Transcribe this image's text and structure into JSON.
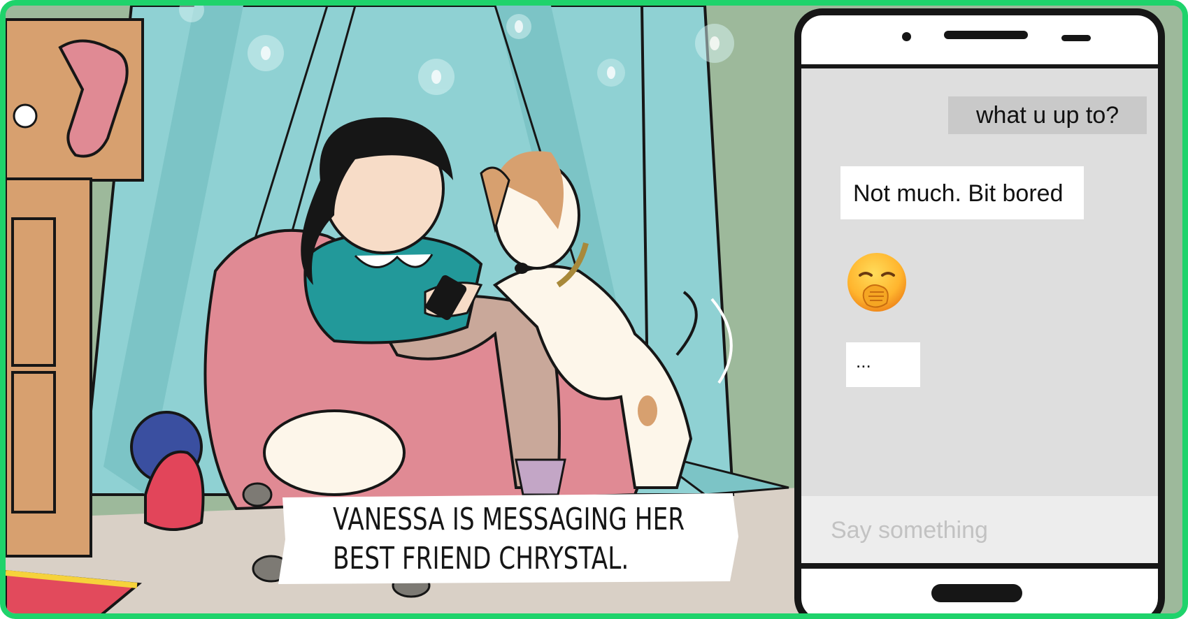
{
  "caption": {
    "line1": "VANESSA IS MESSAGING HER",
    "line2": "BEST FRIEND CHRYSTAL."
  },
  "chat": {
    "messages": [
      {
        "from": "sent",
        "text": "what u up to?"
      },
      {
        "from": "received",
        "text": "Not much. Bit bored"
      },
      {
        "from": "received",
        "emoji": "yawning-face"
      },
      {
        "from": "received",
        "text": "..."
      }
    ],
    "input_placeholder": "Say something"
  },
  "colors": {
    "frame": "#1fd36b",
    "wall": "#9db99b",
    "tent": "#8fd1d3",
    "beanbag": "#e08a94",
    "shirt": "#22999a",
    "phone_screen": "#dedede",
    "sent_bubble": "#c9c9c9",
    "received_bubble": "#ffffff"
  }
}
